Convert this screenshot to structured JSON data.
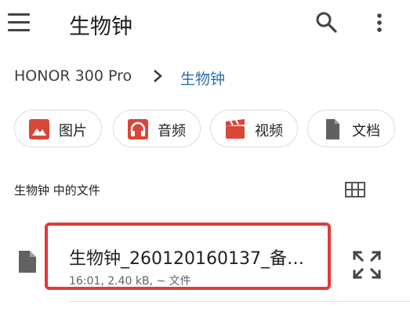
{
  "header": {
    "title": "生物钟"
  },
  "breadcrumb": {
    "root": "HONOR 300 Pro",
    "current": "生物钟"
  },
  "filters": {
    "images": "图片",
    "audio": "音频",
    "video": "视频",
    "documents": "文档"
  },
  "section": {
    "title": "生物钟 中的文件"
  },
  "file": {
    "name": "生物钟_260120160137_备…",
    "meta": "16:01, 2.40 kB, ~ 文件"
  },
  "colors": {
    "accent_blue": "#2a6db3",
    "chip_red": "#d9473a",
    "highlight_red": "#e53935"
  }
}
